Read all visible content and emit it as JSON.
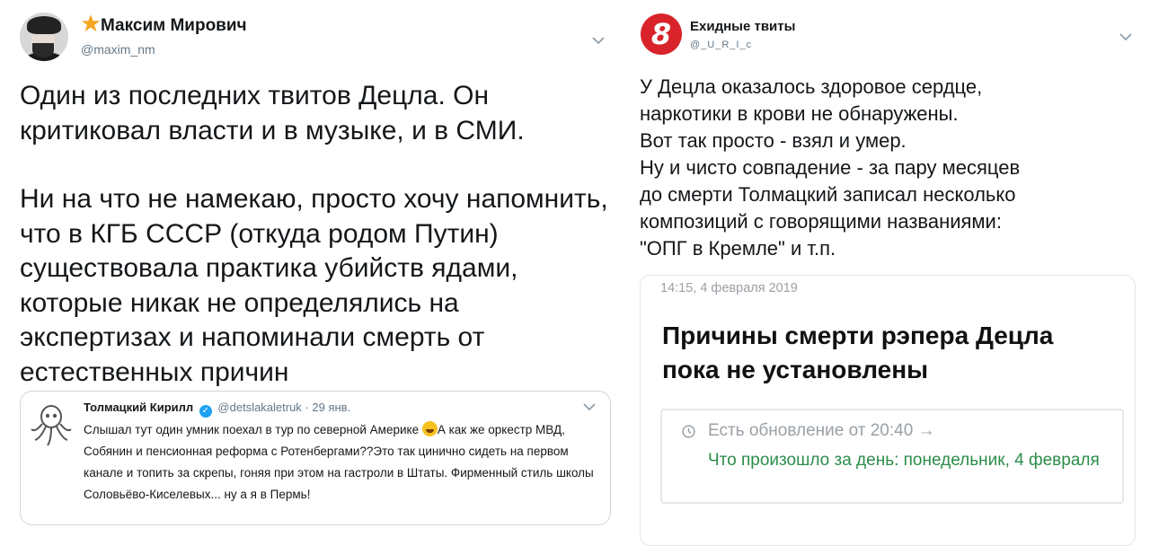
{
  "left_tweet": {
    "author_name": "Максим Мирович",
    "author_handle": "@maxim_nm",
    "paragraph_1": "Один из последних твитов Децла. Он критиковал власти и в музыке, и в СМИ.",
    "paragraph_2": "Ни на что не намекаю, просто хочу напомнить, что в КГБ СССР (откуда родом Путин) существовала практика убийств ядами, которые никак не определялись на экспертизах и напоминали смерть от естественных причин",
    "quoted": {
      "author_name": "Толмацкий Кирилл",
      "author_handle": "@detslakaletruk",
      "date": "· 29 янв.",
      "text_before_emoji": "Слышал тут один умник поехал в тур по северной Америке ",
      "text_after_emoji": "А как же оркестр МВД, Собянин и пенсионная реформа с Ротенбергами??Это так цинично сидеть на первом канале и топить за скрепы, гоняя при этом на гастроли в Штаты. Фирменный стиль школы Соловьёво-Киселевых... ну а я в Пермь!"
    }
  },
  "right_tweet": {
    "author_name": "Ехидные твиты",
    "author_handle": "@_U_R_I_c",
    "avatar_text": "8",
    "lines": [
      "У Децла оказалось здоровое сердце,",
      "наркотики в крови не обнаружены.",
      "Вот так просто - взял и умер.",
      "Ну и чисто совпадение - за пару месяцев",
      "до смерти Толмацкий записал несколько",
      "композиций с говорящими названиями:",
      "\"ОПГ в Кремле\" и т.п."
    ],
    "card": {
      "date": "14:15, 4 февраля 2019",
      "headline": "Причины смерти рэпера Децла пока не установлены",
      "update_text": "Есть обновление от 20:40 →",
      "update_link": "Что произошло за день: понедельник, 4 февраля"
    }
  },
  "colors": {
    "text": "#14171a",
    "secondary": "#657786",
    "verified": "#1da1f2",
    "link_green": "#2c8c4a",
    "avatar_red": "#d8232a"
  }
}
